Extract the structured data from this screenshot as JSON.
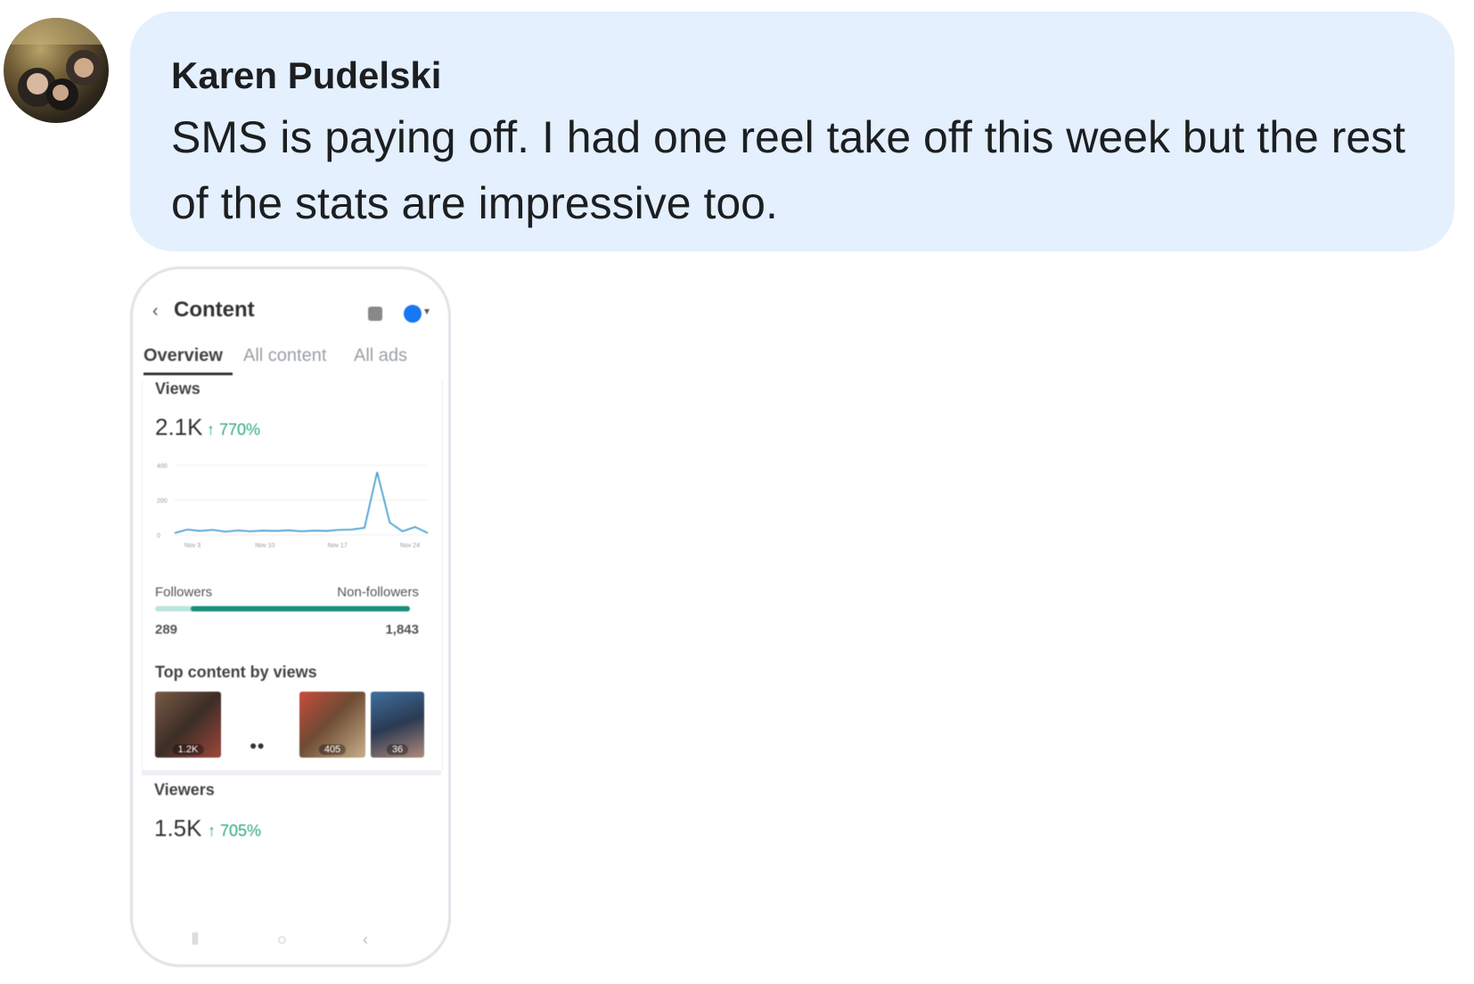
{
  "post": {
    "author": "Karen Pudelski",
    "message": "SMS is paying off. I had one reel take off this week but the rest of the stats are impressive too."
  },
  "screenshot": {
    "header_title": "Content",
    "back_icon": "chevron-left-icon",
    "tabs": [
      "Overview",
      "All content",
      "All ads"
    ],
    "active_tab": "Overview",
    "views": {
      "label": "Views",
      "value": "2.1K",
      "change": "↑ 770%",
      "change_color": "#2aa87a"
    },
    "chart_data": {
      "type": "line",
      "title": "",
      "y_ticks": [
        "400",
        "200",
        "0"
      ],
      "x_ticks": [
        "Nov 3",
        "Nov 10",
        "Nov 17",
        "Nov 24"
      ],
      "ylim": [
        0,
        420
      ],
      "series": [
        {
          "color": "#4a9fd1",
          "values": [
            10,
            30,
            22,
            28,
            18,
            25,
            20,
            24,
            22,
            26,
            20,
            24,
            22,
            28,
            30,
            40,
            360,
            70,
            20,
            45,
            10
          ]
        }
      ]
    },
    "audience": {
      "followers_label": "Followers",
      "nonfollowers_label": "Non-followers",
      "followers_value": "289",
      "nonfollowers_value": "1,843",
      "nonfollowers_fraction": 0.86
    },
    "top_content": {
      "label": "Top content by views",
      "items": [
        "1.2K",
        "",
        "405",
        "36"
      ]
    },
    "viewers": {
      "label": "Viewers",
      "value": "1.5K",
      "change": "↑ 705%"
    }
  }
}
